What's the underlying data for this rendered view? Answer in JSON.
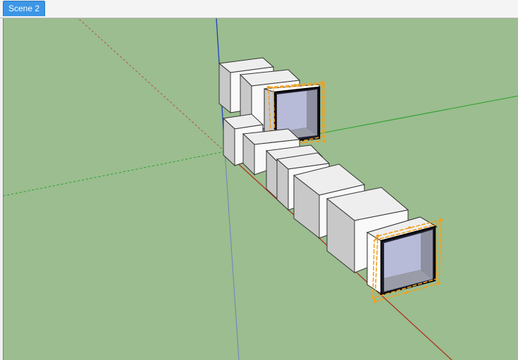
{
  "scene_tabs": [
    {
      "label": "Scene 2",
      "active": true
    }
  ],
  "colors": {
    "ground": "#9bbd8f",
    "face_front": "#cfcfcf",
    "face_side": "#ffffff",
    "selection": "#f0a020",
    "x_axis": "#b03020",
    "y_axis": "#2aa02a",
    "z_axis": "#1f3fc0",
    "accent": "#3c96e6"
  },
  "selection_count": 2
}
